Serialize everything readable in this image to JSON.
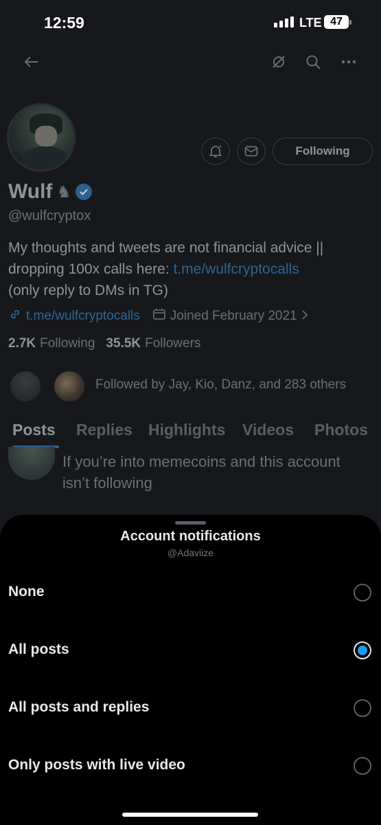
{
  "status_bar": {
    "time": "12:59",
    "network": "LTE",
    "battery": "47"
  },
  "top_bar": {
    "back_icon": "arrow-left-icon",
    "icons": [
      "no-notification-icon",
      "search-icon",
      "more-icon"
    ]
  },
  "profile": {
    "name": "Wulf",
    "handle": "@wulfcryptox",
    "bio_line1": "My thoughts and tweets are not financial advice ||",
    "bio_line2_prefix": "dropping 100x calls here: ",
    "bio_link": "t.me/wulfcryptocalls",
    "bio_line3": "(only reply to DMs in TG)",
    "website": "t.me/wulfcryptocalls",
    "joined": "Joined February 2021",
    "following_count": "2.7K",
    "following_label": "Following",
    "followers_count": "35.5K",
    "followers_label": "Followers",
    "followed_by": "Followed by Jay, Kio, Danz, and 283 others",
    "following_button": "Following"
  },
  "tabs": [
    "Posts",
    "Replies",
    "Highlights",
    "Videos",
    "Photos"
  ],
  "post_preview": {
    "line1": "If you’re into memecoins and this account",
    "line2": "isn’t following"
  },
  "sheet": {
    "title": "Account notifications",
    "subtitle": "@Adaviize",
    "options": [
      {
        "label": "None",
        "selected": false
      },
      {
        "label": "All posts",
        "selected": true
      },
      {
        "label": "All posts and replies",
        "selected": false
      },
      {
        "label": "Only posts with live video",
        "selected": false
      }
    ]
  },
  "colors": {
    "accent": "#1d9bf0",
    "sheet_bg": "#000000",
    "dimmed_bg": "#16181c"
  }
}
